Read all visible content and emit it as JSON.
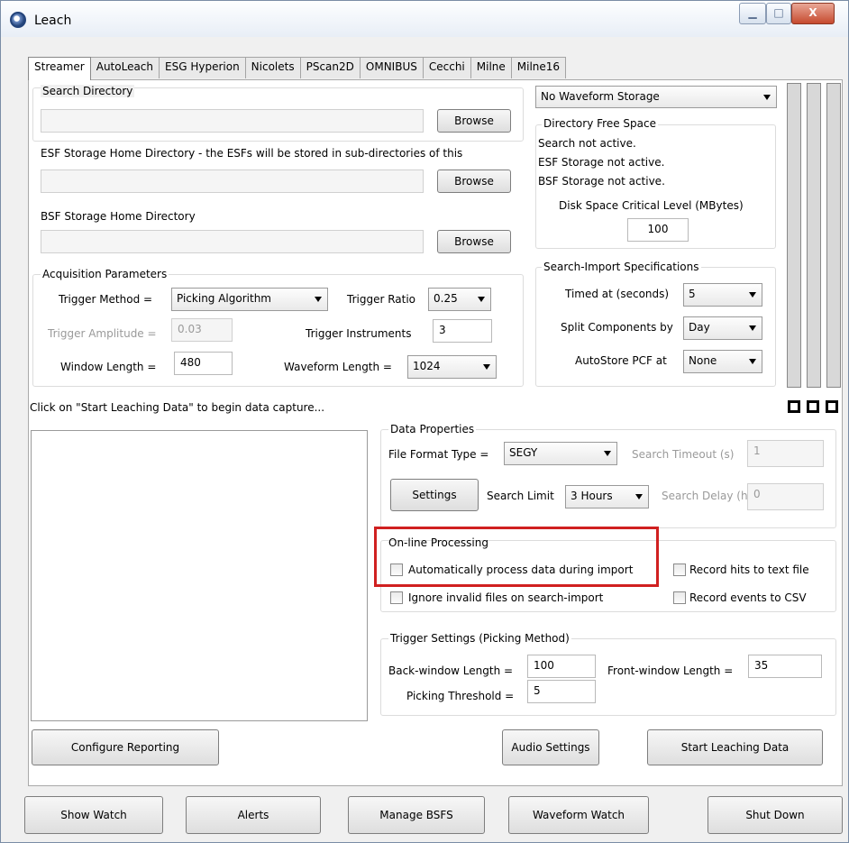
{
  "window": {
    "title": "Leach",
    "minimize_glyph": "▁",
    "maximize_glyph": "□",
    "close_glyph": "X"
  },
  "tabs": [
    "Streamer",
    "AutoLeach",
    "ESG Hyperion",
    "Nicolets",
    "PScan2D",
    "OMNIBUS",
    "Cecchi",
    "Milne",
    "Milne16"
  ],
  "directories": {
    "search_label": "Search Directory",
    "esf_label": "ESF Storage Home Directory - the ESFs will be stored in sub-directories of this",
    "bsf_label": "BSF Storage Home Directory",
    "browse": "Browse"
  },
  "acquisition": {
    "title": "Acquisition Parameters",
    "trigger_method_label": "Trigger Method =",
    "trigger_method": "Picking Algorithm",
    "trigger_ratio_label": "Trigger Ratio",
    "trigger_ratio": "0.25",
    "trigger_amplitude_label": "Trigger Amplitude =",
    "trigger_amplitude": "0.03",
    "trigger_instruments_label": "Trigger Instruments",
    "trigger_instruments": "3",
    "window_length_label": "Window Length =",
    "window_length": "480",
    "waveform_length_label": "Waveform Length =",
    "waveform_length": "1024"
  },
  "storage": {
    "waveform_storage": "No Waveform Storage",
    "free_space_title": "Directory Free Space",
    "status1": "Search not active.",
    "status2": "ESF Storage not active.",
    "status3": "BSF Storage not active.",
    "critical_label": "Disk Space Critical Level (MBytes)",
    "critical_value": "100"
  },
  "search_import": {
    "title": "Search-Import Specifications",
    "timed_label": "Timed at (seconds)",
    "timed_value": "5",
    "split_label": "Split Components by",
    "split_value": "Day",
    "autostore_label": "AutoStore PCF at",
    "autostore_value": "None"
  },
  "status_message": "Click on \"Start Leaching Data\" to begin data capture...",
  "data_properties": {
    "title": "Data Properties",
    "file_format_label": "File Format Type =",
    "file_format": "SEGY",
    "search_timeout_label": "Search Timeout (s)",
    "search_timeout": "1",
    "settings": "Settings",
    "search_limit_label": "Search Limit",
    "search_limit": "3 Hours",
    "search_delay_label": "Search Delay (hrs)",
    "search_delay": "0"
  },
  "online": {
    "title": "On-line Processing",
    "auto_process": "Automatically process data during import",
    "ignore_invalid": "Ignore invalid files on search-import",
    "record_hits": "Record hits to text file",
    "record_events": "Record events to CSV"
  },
  "trigger_settings": {
    "title": "Trigger Settings (Picking Method)",
    "back_label": "Back-window Length =",
    "back_value": "100",
    "front_label": "Front-window Length =",
    "front_value": "35",
    "threshold_label": "Picking Threshold =",
    "threshold_value": "5"
  },
  "panel_buttons": {
    "configure": "Configure Reporting",
    "audio": "Audio Settings",
    "start": "Start Leaching Data"
  },
  "bottom_buttons": {
    "show_watch": "Show Watch",
    "alerts": "Alerts",
    "manage_bsfs": "Manage BSFS",
    "waveform_watch": "Waveform Watch",
    "shut_down": "Shut Down"
  },
  "colors": {
    "highlight": "#d02020"
  }
}
